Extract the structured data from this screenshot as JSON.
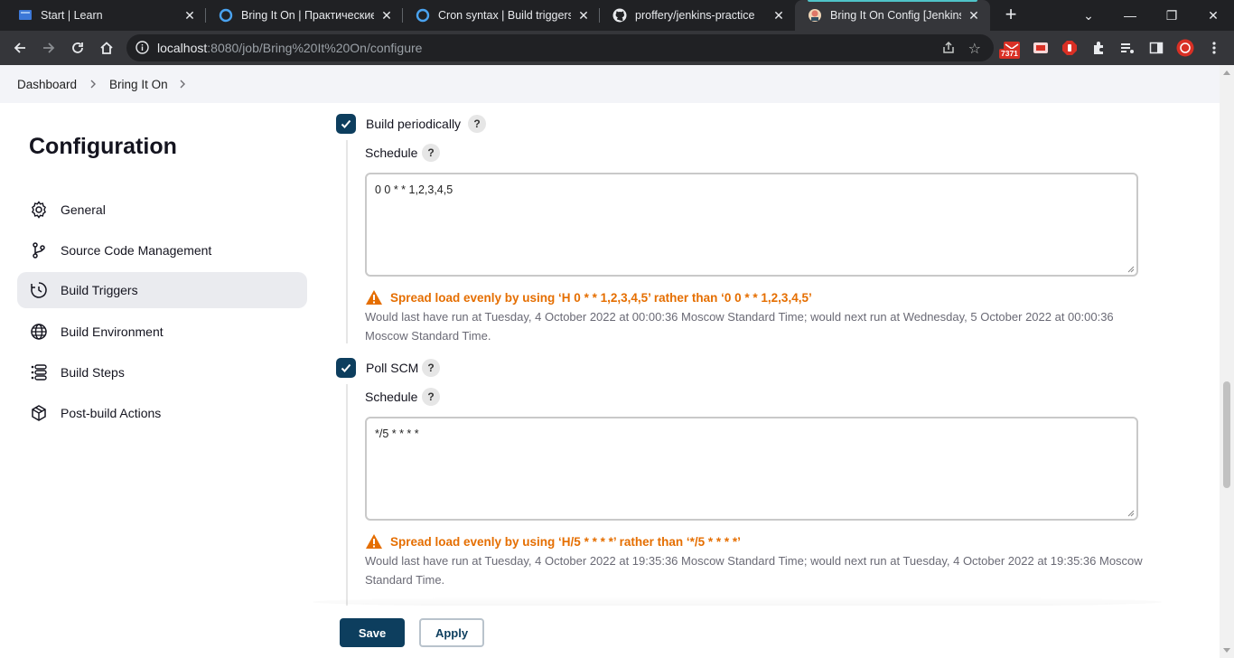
{
  "browser": {
    "tabs": [
      {
        "title": "Start | Learn",
        "icon": "learn-icon"
      },
      {
        "title": "Bring It On | Практические з",
        "icon": "circle-logo-icon"
      },
      {
        "title": "Cron syntax | Build triggers |",
        "icon": "circle-logo-icon"
      },
      {
        "title": "proffery/jenkins-practice",
        "icon": "github-icon"
      },
      {
        "title": "Bring It On Config [Jenkins]",
        "icon": "jenkins-icon",
        "active": true
      }
    ],
    "url_host": "localhost",
    "url_rest": ":8080/job/Bring%20It%20On/configure",
    "ext_badge": "7371"
  },
  "breadcrumbs": {
    "dashboard": "Dashboard",
    "job": "Bring It On"
  },
  "sidebar": {
    "title": "Configuration",
    "items": [
      {
        "label": "General",
        "icon": "gear-icon"
      },
      {
        "label": "Source Code Management",
        "icon": "branch-icon"
      },
      {
        "label": "Build Triggers",
        "icon": "clock-icon",
        "active": true
      },
      {
        "label": "Build Environment",
        "icon": "globe-icon"
      },
      {
        "label": "Build Steps",
        "icon": "list-icon"
      },
      {
        "label": "Post-build Actions",
        "icon": "package-icon"
      }
    ]
  },
  "triggers": {
    "build_periodically": {
      "label": "Build periodically",
      "checked": true,
      "schedule_label": "Schedule",
      "schedule_value": "0 0 * * 1,2,3,4,5",
      "warning": "Spread load evenly by using ‘H 0 * * 1,2,3,4,5’ rather than ‘0 0 * * 1,2,3,4,5’",
      "info": "Would last have run at Tuesday, 4 October 2022 at 00:00:36 Moscow Standard Time; would next run at Wednesday, 5 October 2022 at 00:00:36 Moscow Standard Time."
    },
    "poll_scm": {
      "label": "Poll SCM",
      "checked": true,
      "schedule_label": "Schedule",
      "schedule_value": "*/5 * * * *",
      "warning": "Spread load evenly by using ‘H/5 * * * *’ rather than ‘*/5 * * * *’",
      "info": "Would last have run at Tuesday, 4 October 2022 at 19:35:36 Moscow Standard Time; would next run at Tuesday, 4 October 2022 at 19:35:36 Moscow Standard Time."
    }
  },
  "help_glyph": "?",
  "buttons": {
    "save": "Save",
    "apply": "Apply"
  },
  "colors": {
    "primary": "#0d3e5e",
    "warning": "#e56e00",
    "chrome_dark": "#202124"
  }
}
